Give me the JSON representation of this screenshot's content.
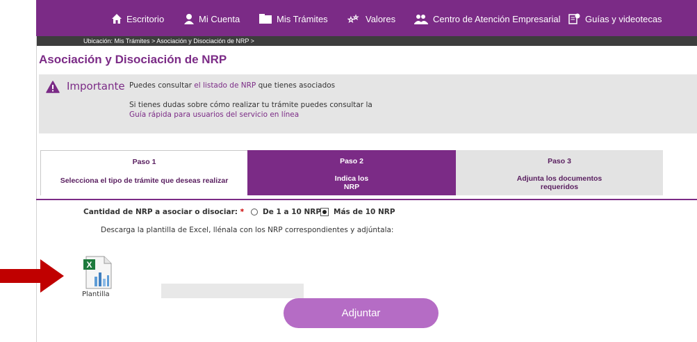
{
  "nav": {
    "items": [
      {
        "icon": "home-icon",
        "label": "Escritorio"
      },
      {
        "icon": "user-icon",
        "label": "Mi Cuenta"
      },
      {
        "icon": "folder-icon",
        "label": "Mis Trámites"
      },
      {
        "icon": "stars-icon",
        "label": "Valores"
      },
      {
        "icon": "people-icon",
        "label": "Centro de Atención Empresarial"
      },
      {
        "icon": "guide-icon",
        "label": "Guías y videotecas"
      }
    ]
  },
  "breadcrumb": "Ubicación: Mis Trámites > Asociación y Disociación de NRP >",
  "page_title": "Asociación y Disociación de NRP",
  "notice": {
    "heading": "Importante",
    "line1_pre": "Puedes consultar ",
    "line1_link": "el listado de NRP",
    "line1_post": " que tienes asociados",
    "line2": "Si tienes dudas sobre cómo realizar tu trámite puedes consultar la",
    "line3_link": "Guía rápida para usuarios del servicio en línea"
  },
  "steps": [
    {
      "num": "Paso 1",
      "desc_a": "Selecciona el tipo de trámite que deseas realizar",
      "desc_b": ""
    },
    {
      "num": "Paso 2",
      "desc_a": "Indica los",
      "desc_b": "NRP"
    },
    {
      "num": "Paso 3",
      "desc_a": "Adjunta los documentos",
      "desc_b": "requeridos"
    }
  ],
  "form": {
    "qty_label": "Cantidad de NRP a asociar o disociar:",
    "required_mark": "*",
    "option_1": "De 1 a 10 NRP",
    "option_2": "Más de 10 NRP",
    "selected_option": "Más de 10 NRP",
    "instructions": "Descarga la plantilla de Excel, llénala con los NRP correspondientes y adjúntala:"
  },
  "file": {
    "label": "Plantilla",
    "icon": "excel-file-icon"
  },
  "attach_button": "Adjuntar",
  "colors": {
    "brand": "#7b2b86",
    "button": "#b56cc5",
    "arrow": "#c00000"
  }
}
